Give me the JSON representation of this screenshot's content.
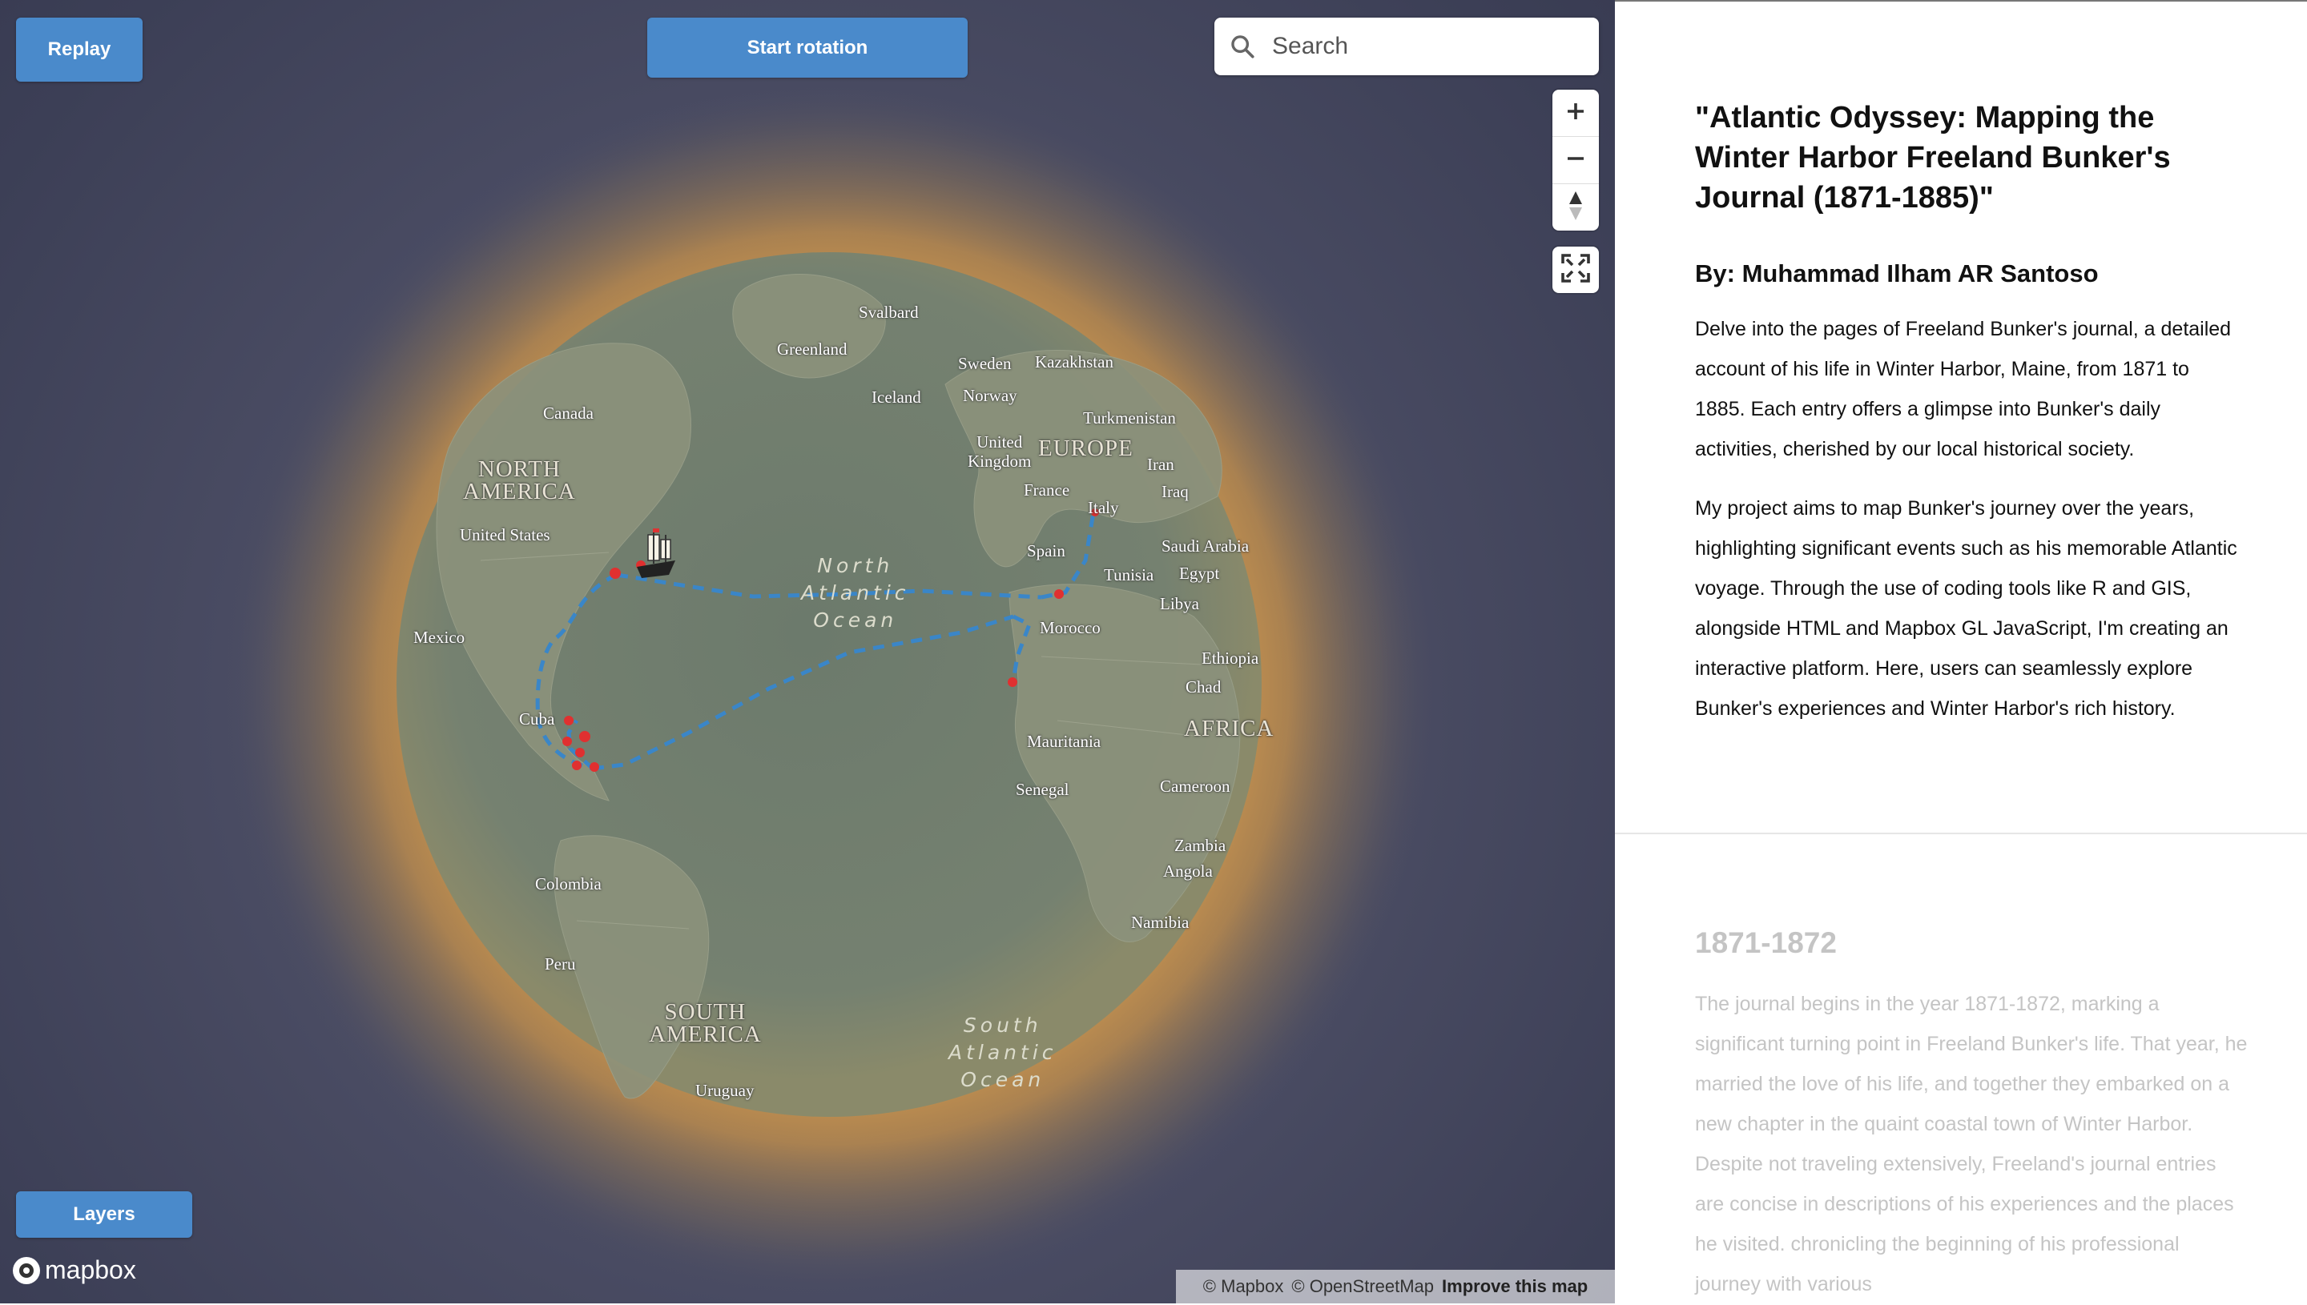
{
  "map": {
    "replay_label": "Replay",
    "rotation_label": "Start rotation",
    "layers_label": "Layers",
    "search_placeholder": "Search",
    "logo_text": "mapbox",
    "attribution": {
      "mapbox": "© Mapbox",
      "osm": "© OpenStreetMap",
      "improve": "Improve this map"
    },
    "labels": {
      "svalbard": "Svalbard",
      "greenland": "Greenland",
      "sweden": "Sweden",
      "kazakhstan": "Kazakhstan",
      "norway": "Norway",
      "iceland": "Iceland",
      "canada": "Canada",
      "turkmenistan": "Turkmenistan",
      "north_america": "NORTH\nAMERICA",
      "uk": "United\nKingdom",
      "europe": "EUROPE",
      "iran": "Iran",
      "france": "France",
      "iraq": "Iraq",
      "italy": "Italy",
      "united_states": "United States",
      "saudi_arabia": "Saudi Arabia",
      "spain": "Spain",
      "north_atlantic": "North\nAtlantic\nOcean",
      "tunisia": "Tunisia",
      "egypt": "Egypt",
      "libya": "Libya",
      "mexico": "Mexico",
      "morocco": "Morocco",
      "ethiopia": "Ethiopia",
      "chad": "Chad",
      "cuba": "Cuba",
      "africa": "AFRICA",
      "mauritania": "Mauritania",
      "senegal": "Senegal",
      "cameroon": "Cameroon",
      "zambia": "Zambia",
      "angola": "Angola",
      "colombia": "Colombia",
      "namibia": "Namibia",
      "peru": "Peru",
      "south_america": "SOUTH\nAMERICA",
      "south_atlantic": "South\nAtlantic\nOcean",
      "uruguay": "Uruguay"
    }
  },
  "panel": {
    "title": "\"Atlantic Odyssey: Mapping the Winter Harbor Freeland Bunker's Journal (1871-1885)\"",
    "author": "By: Muhammad Ilham AR Santoso",
    "paragraphs": [
      "Delve into the pages of Freeland Bunker's journal, a detailed account of his life in Winter Harbor, Maine, from 1871 to 1885. Each entry offers a glimpse into Bunker's daily activities, cherished by our local historical society.",
      "My project aims to map Bunker's journey over the years, highlighting significant events such as his memorable Atlantic voyage. Through the use of coding tools like R and GIS, alongside HTML and Mapbox GL JavaScript, I'm creating an interactive platform. Here, users can seamlessly explore Bunker's experiences and Winter Harbor's rich history."
    ],
    "chapter": {
      "heading": "1871-1872",
      "text": "The journal begins in the year 1871-1872, marking a significant turning point in Freeland Bunker's life. That year, he married the love of his life, and together they embarked on a new chapter in the quaint coastal town of Winter Harbor. Despite not traveling extensively, Freeland's journal entries are concise in descriptions of his experiences and the places he visited. chronicling the beginning of his professional journey with various"
    }
  },
  "colors": {
    "button": "#4a8acb",
    "route": "#3a86c8",
    "stop": "#e03030",
    "glow": "#d9a04a"
  },
  "icons": [
    "search-icon",
    "zoom-in-icon",
    "zoom-out-icon",
    "compass-icon",
    "fullscreen-icon",
    "ship-icon",
    "mapbox-logo-icon"
  ]
}
